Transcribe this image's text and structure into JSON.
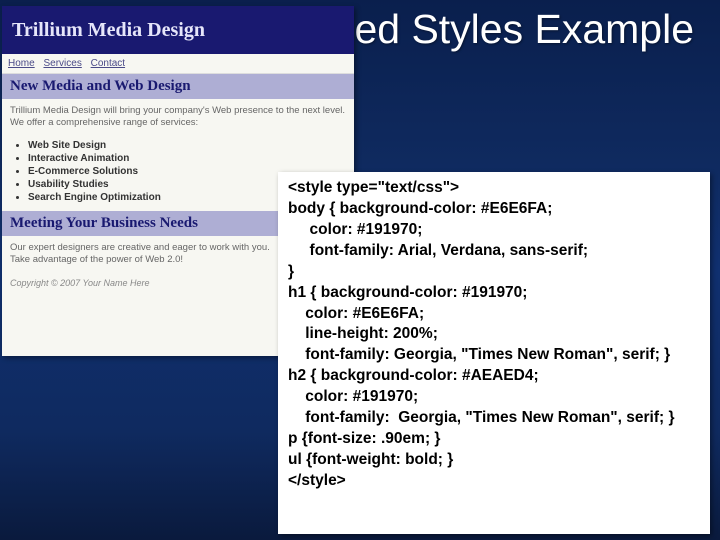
{
  "slide_title": "Embedded Styles Example",
  "example_page": {
    "h1": "Trillium Media Design",
    "nav": [
      "Home",
      "Services",
      "Contact"
    ],
    "h2a": "New Media and Web Design",
    "intro_line1": "Trillium Media Design will bring your company's Web presence to the next level.",
    "intro_line2": "We offer a comprehensive range of services:",
    "list": [
      "Web Site Design",
      "Interactive Animation",
      "E-Commerce Solutions",
      "Usability Studies",
      "Search Engine Optimization"
    ],
    "h2b": "Meeting Your Business Needs",
    "meet_line1": "Our expert designers are creative and eager to work with you.",
    "meet_line2": "Take advantage of the power of Web 2.0!",
    "copyright": "Copyright © 2007 Your Name Here"
  },
  "code": "<style type=\"text/css\">\nbody { background-color: #E6E6FA;\n     color: #191970;\n     font-family: Arial, Verdana, sans-serif;\n}\nh1 { background-color: #191970;\n    color: #E6E6FA;\n    line-height: 200%;\n    font-family: Georgia, \"Times New Roman\", serif; }\nh2 { background-color: #AEAED4;\n    color: #191970;\n    font-family:  Georgia, \"Times New Roman\", serif; }\np {font-size: .90em; }\nul {font-weight: bold; }\n</style>"
}
